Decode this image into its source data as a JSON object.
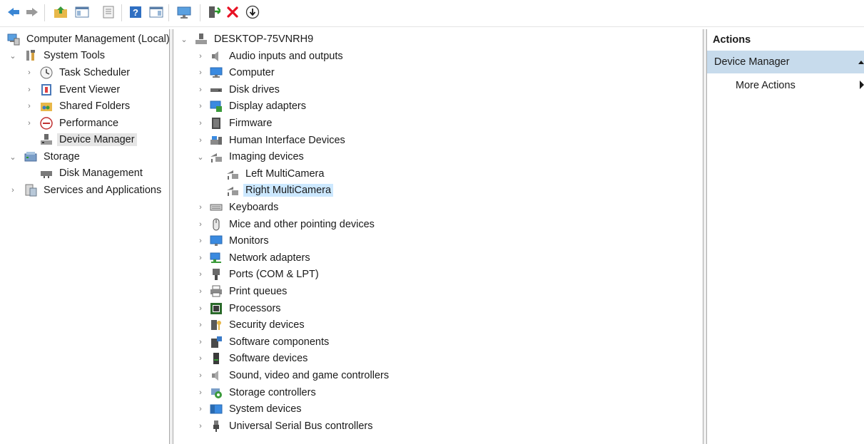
{
  "toolbar": {
    "buttons": [
      "back-icon",
      "forward-icon",
      "up-folder-icon",
      "show-hide-console-tree-icon",
      "properties-icon",
      "help-icon",
      "show-action-pane-icon",
      "monitor-icon",
      "update-driver-icon",
      "uninstall-icon",
      "scan-hardware-icon"
    ]
  },
  "left_tree": {
    "root": "Computer Management (Local)",
    "system_tools": "System Tools",
    "task_scheduler": "Task Scheduler",
    "event_viewer": "Event Viewer",
    "shared_folders": "Shared Folders",
    "performance": "Performance",
    "device_manager": "Device Manager",
    "storage": "Storage",
    "disk_management": "Disk Management",
    "services_apps": "Services and Applications"
  },
  "device_tree": {
    "computer_name": "DESKTOP-75VNRH9",
    "categories": [
      "Audio inputs and outputs",
      "Computer",
      "Disk drives",
      "Display adapters",
      "Firmware",
      "Human Interface Devices",
      "Imaging devices",
      "Keyboards",
      "Mice and other pointing devices",
      "Monitors",
      "Network adapters",
      "Ports (COM & LPT)",
      "Print queues",
      "Processors",
      "Security devices",
      "Software components",
      "Software devices",
      "Sound, video and game controllers",
      "Storage controllers",
      "System devices",
      "Universal Serial Bus controllers"
    ],
    "imaging_children": [
      "Left MultiCamera",
      "Right MultiCamera"
    ]
  },
  "actions": {
    "title": "Actions",
    "section": "Device Manager",
    "more_actions": "More Actions"
  },
  "colors": {
    "selection_blue": "#cce8ff",
    "actions_header": "#c7dbec",
    "uninstall_red": "#e81123"
  }
}
